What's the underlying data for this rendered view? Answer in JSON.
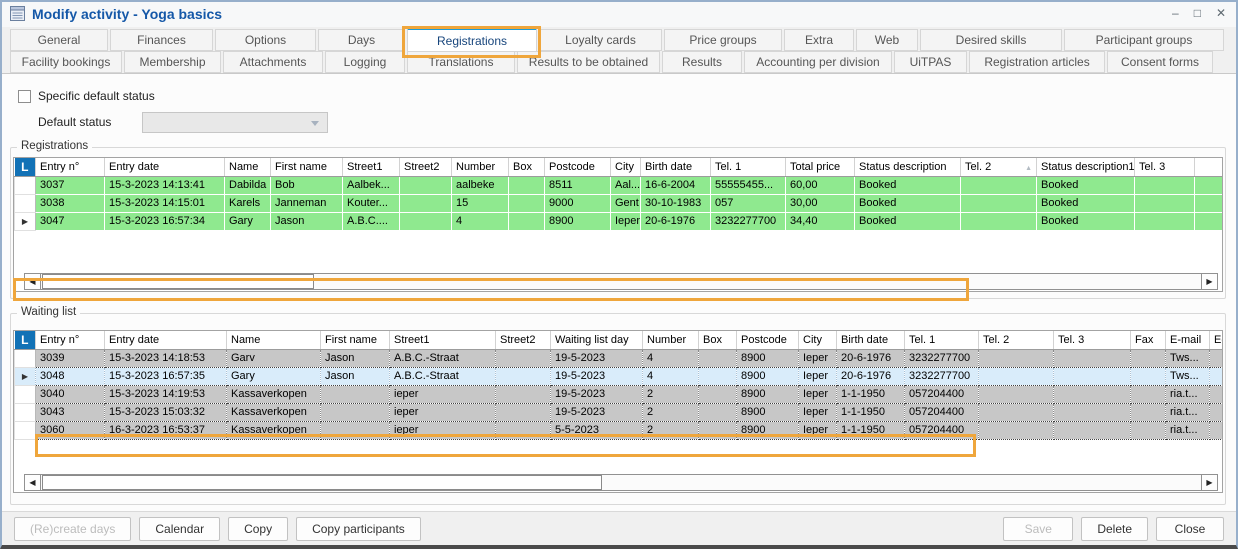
{
  "window": {
    "title": "Modify activity - Yoga basics",
    "minimize": "–",
    "maximize": "□",
    "close": "✕"
  },
  "tabs_row1": [
    {
      "label": "General"
    },
    {
      "label": "Finances"
    },
    {
      "label": "Options"
    },
    {
      "label": "Days"
    },
    {
      "label": "Registrations",
      "selected": true
    },
    {
      "label": "Loyalty cards"
    },
    {
      "label": "Price groups"
    },
    {
      "label": "Extra"
    },
    {
      "label": "Web"
    },
    {
      "label": "Desired skills"
    },
    {
      "label": "Participant groups"
    }
  ],
  "tabs_row2": [
    {
      "label": "Facility bookings"
    },
    {
      "label": "Membership"
    },
    {
      "label": "Attachments"
    },
    {
      "label": "Logging"
    },
    {
      "label": "Translations"
    },
    {
      "label": "Results to be obtained"
    },
    {
      "label": "Results"
    },
    {
      "label": "Accounting per division"
    },
    {
      "label": "UiTPAS"
    },
    {
      "label": "Registration articles"
    },
    {
      "label": "Consent forms"
    }
  ],
  "settings": {
    "checkbox_label": "Specific default status",
    "checkbox_checked": false,
    "default_status_label": "Default status",
    "default_status_value": ""
  },
  "registrations_grid": {
    "group_label": "Registrations",
    "row_header": "L",
    "sorted_column": "Tel. 2",
    "sort_direction": "asc",
    "columns": [
      "Entry n°",
      "Entry date",
      "Name",
      "First name",
      "Street1",
      "Street2",
      "Number",
      "Box",
      "Postcode",
      "City",
      "Birth date",
      "Tel. 1",
      "Total price",
      "Status description",
      "Tel. 2",
      "Status description1",
      "Tel. 3",
      ""
    ],
    "rows": [
      {
        "current": false,
        "cells": [
          "3037",
          "15-3-2023 14:13:41",
          "Dabilda",
          "Bob",
          "Aalbek...",
          "",
          "aalbeke",
          "",
          "8511",
          "Aal...",
          "16-6-2004",
          "55555455...",
          "60,00",
          "Booked",
          "",
          "Booked",
          "",
          ""
        ]
      },
      {
        "current": false,
        "cells": [
          "3038",
          "15-3-2023 14:15:01",
          "Karels",
          "Janneman",
          "Kouter...",
          "",
          "15",
          "",
          "9000",
          "Gent",
          "30-10-1983",
          "057",
          "30,00",
          "Booked",
          "",
          "Booked",
          "",
          ""
        ]
      },
      {
        "current": true,
        "cells": [
          "3047",
          "15-3-2023 16:57:34",
          "Gary",
          "Jason",
          "A.B.C....",
          "",
          "4",
          "",
          "8900",
          "Ieper",
          "20-6-1976",
          "3232277700",
          "34,40",
          "Booked",
          "",
          "Booked",
          "",
          ""
        ]
      }
    ]
  },
  "waiting_grid": {
    "group_label": "Waiting list",
    "row_header": "L",
    "sorted_column": "",
    "columns": [
      "Entry n°",
      "Entry date",
      "Name",
      "First name",
      "Street1",
      "Street2",
      "Waiting list day",
      "Number",
      "Box",
      "Postcode",
      "City",
      "Birth date",
      "Tel. 1",
      "Tel. 2",
      "Tel. 3",
      "Fax",
      "E-mail",
      "E-"
    ],
    "rows": [
      {
        "current": false,
        "selected": false,
        "cells": [
          "3039",
          "15-3-2023 14:18:53",
          "Garv",
          "Jason",
          "A.B.C.-Straat",
          "",
          "19-5-2023",
          "4",
          "",
          "8900",
          "Ieper",
          "20-6-1976",
          "3232277700",
          "",
          "",
          "",
          "Tws...",
          ""
        ]
      },
      {
        "current": true,
        "selected": true,
        "cells": [
          "3048",
          "15-3-2023 16:57:35",
          "Gary",
          "Jason",
          "A.B.C.-Straat",
          "",
          "19-5-2023",
          "4",
          "",
          "8900",
          "Ieper",
          "20-6-1976",
          "3232277700",
          "",
          "",
          "",
          "Tws...",
          ""
        ]
      },
      {
        "current": false,
        "selected": false,
        "cells": [
          "3040",
          "15-3-2023 14:19:53",
          "Kassaverkopen",
          "",
          "ieper",
          "",
          "19-5-2023",
          "2",
          "",
          "8900",
          "Ieper",
          "1-1-1950",
          "057204400",
          "",
          "",
          "",
          "ria.t...",
          ""
        ]
      },
      {
        "current": false,
        "selected": false,
        "cells": [
          "3043",
          "15-3-2023 15:03:32",
          "Kassaverkopen",
          "",
          "ieper",
          "",
          "19-5-2023",
          "2",
          "",
          "8900",
          "Ieper",
          "1-1-1950",
          "057204400",
          "",
          "",
          "",
          "ria.t...",
          ""
        ]
      },
      {
        "current": false,
        "selected": false,
        "cells": [
          "3060",
          "16-3-2023 16:53:37",
          "Kassaverkopen",
          "",
          "ieper",
          "",
          "5-5-2023",
          "2",
          "",
          "8900",
          "Ieper",
          "1-1-1950",
          "057204400",
          "",
          "",
          "",
          "ria.t...",
          ""
        ]
      }
    ]
  },
  "footer": {
    "left_buttons": [
      {
        "label": "(Re)create days",
        "disabled": true
      },
      {
        "label": "Calendar",
        "disabled": false
      },
      {
        "label": "Copy",
        "disabled": false
      },
      {
        "label": "Copy participants",
        "disabled": false
      }
    ],
    "right_buttons": [
      {
        "label": "Save",
        "disabled": true
      },
      {
        "label": "Delete",
        "disabled": false
      },
      {
        "label": "Close",
        "disabled": false
      }
    ]
  },
  "colors": {
    "highlight_orange": "#EFA63C",
    "registration_row_green": "#8FE98F",
    "waiting_row_gray": "#C7C7C7",
    "selected_row_blue": "#D9ECFA",
    "tab_accent_blue": "#1B9DDB",
    "row_header_blue": "#1272B6",
    "title_text_blue": "#1558A8"
  }
}
